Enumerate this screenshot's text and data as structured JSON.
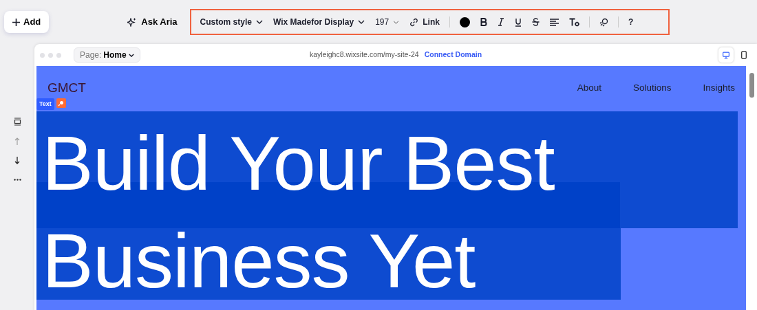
{
  "add_button": {
    "label": "Add"
  },
  "ask_aria": {
    "label": "Ask Aria"
  },
  "text_toolbar": {
    "style": "Custom style",
    "font": "Wix Madefor Display",
    "size": "197",
    "link": "Link",
    "help": "?"
  },
  "browser": {
    "page_label": "Page:",
    "page_name": "Home",
    "url": "kayleighc8.wixsite.com/my-site-24",
    "connect_domain": "Connect Domain",
    "devices": [
      {
        "kind": "desktop",
        "selected": true
      },
      {
        "kind": "mobile",
        "selected": false
      }
    ]
  },
  "site": {
    "logo": "GMCT",
    "nav": [
      "About",
      "Solutions",
      "Insights"
    ],
    "selection_tag": "Text",
    "heading_lines": [
      "Build Your Best",
      "Business Yet"
    ]
  }
}
